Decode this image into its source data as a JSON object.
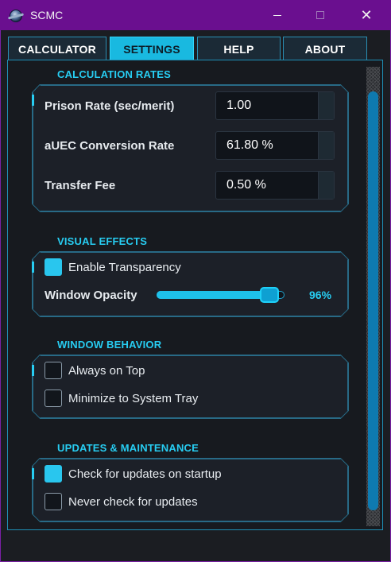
{
  "window": {
    "title": "SCMC",
    "minimize": "",
    "maximize": "",
    "close": "✕"
  },
  "tabs": [
    {
      "label": "CALCULATOR",
      "active": false
    },
    {
      "label": "SETTINGS",
      "active": true
    },
    {
      "label": "HELP",
      "active": false
    },
    {
      "label": "ABOUT",
      "active": false
    }
  ],
  "calculation_rates": {
    "title": "CALCULATION RATES",
    "prison_rate": {
      "label": "Prison Rate (sec/merit)",
      "value": "1.00"
    },
    "auec_rate": {
      "label": "aUEC Conversion Rate",
      "value": "61.80 %"
    },
    "transfer_fee": {
      "label": "Transfer Fee",
      "value": "0.50 %"
    }
  },
  "visual_effects": {
    "title": "VISUAL EFFECTS",
    "transparency": {
      "label": "Enable Transparency",
      "checked": true
    },
    "opacity": {
      "label": "Window Opacity",
      "value_text": "96%",
      "value": 0.96
    }
  },
  "window_behavior": {
    "title": "WINDOW BEHAVIOR",
    "always_on_top": {
      "label": "Always on Top",
      "checked": false
    },
    "minimize_to_tray": {
      "label": "Minimize to System Tray",
      "checked": false
    }
  },
  "updates": {
    "title": "UPDATES & MAINTENANCE",
    "check_startup": {
      "label": "Check for updates on startup",
      "checked": true
    },
    "never_check": {
      "label": "Never check for updates",
      "checked": false
    }
  },
  "colors": {
    "titlebar": "#6a0f8f",
    "accent": "#27cdf2",
    "active_tab": "#19b9e0",
    "background": "#1b1d22"
  }
}
